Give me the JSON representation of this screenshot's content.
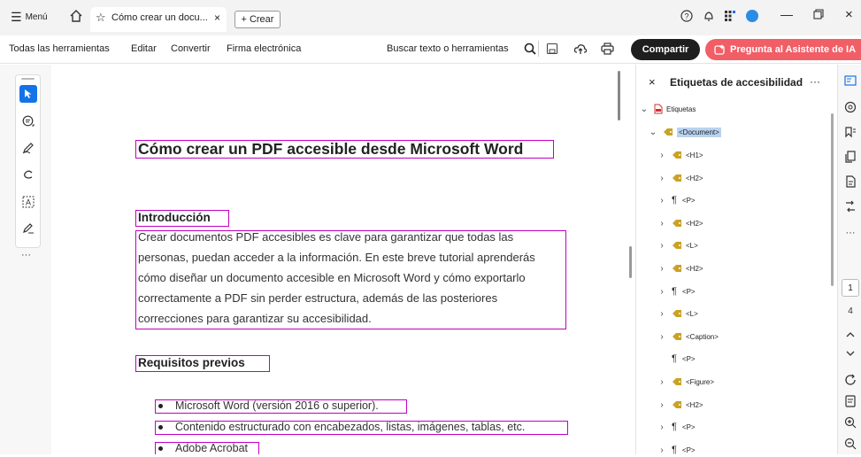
{
  "titlebar": {
    "menu_label": "Menú",
    "tab_title": "Cómo crear un docu...",
    "new_button_label": "Crear",
    "close_tab_glyph": "×"
  },
  "toolbar": {
    "all_tools": "Todas las herramientas",
    "edit": "Editar",
    "convert": "Convertir",
    "esign": "Firma electrónica",
    "search_placeholder": "Buscar texto o herramientas",
    "share_label": "Compartir",
    "ai_assistant_label": "Pregunta al Asistente de IA"
  },
  "document": {
    "title": "Cómo crear un PDF accesible desde Microsoft Word",
    "intro_heading": "Introducción",
    "paragraph_lines": [
      "Crear documentos PDF accesibles es clave para garantizar que todas las",
      "personas, puedan acceder a la información. En este breve tutorial aprenderás",
      "cómo diseñar un documento accesible en Microsoft Word y cómo exportarlo",
      "correctamente a PDF sin perder estructura, además de las posteriores",
      "correcciones para garantizar su accesibilidad."
    ],
    "requirements_heading": "Requisitos previos",
    "bullets": [
      "Microsoft Word (versión 2016 o superior).",
      "Contenido estructurado con encabezados, listas, imágenes, tablas, etc.",
      "Adobe Acrobat"
    ]
  },
  "tag_panel": {
    "close_glyph": "×",
    "title": "Etiquetas de accesibilidad",
    "more_glyph": "···",
    "root_label": "Etiquetas",
    "document_tag": "<Document>",
    "children": [
      {
        "label": "<H1>",
        "kind": "tag",
        "expandable": true
      },
      {
        "label": "<H2>",
        "kind": "tag",
        "expandable": true
      },
      {
        "label": "<P>",
        "kind": "para",
        "expandable": true
      },
      {
        "label": "<H2>",
        "kind": "tag",
        "expandable": true
      },
      {
        "label": "<L>",
        "kind": "tag",
        "expandable": true
      },
      {
        "label": "<H2>",
        "kind": "tag",
        "expandable": true
      },
      {
        "label": "<P>",
        "kind": "para",
        "expandable": true
      },
      {
        "label": "<L>",
        "kind": "tag",
        "expandable": true
      },
      {
        "label": "<Caption>",
        "kind": "tag",
        "expandable": true
      },
      {
        "label": "<P>",
        "kind": "para",
        "expandable": false
      },
      {
        "label": "<Figure>",
        "kind": "tag",
        "expandable": true
      },
      {
        "label": "<H2>",
        "kind": "tag",
        "expandable": true
      },
      {
        "label": "<P>",
        "kind": "para",
        "expandable": true
      },
      {
        "label": "<P>",
        "kind": "para",
        "expandable": true
      }
    ]
  },
  "right_rail": {
    "current_page": "1",
    "total_pages": "4"
  },
  "colors": {
    "tag_box": "#c000c0",
    "ai_button": "#f15e66",
    "selected_tag": "#b9d3f0",
    "tool_active": "#1473e6"
  }
}
